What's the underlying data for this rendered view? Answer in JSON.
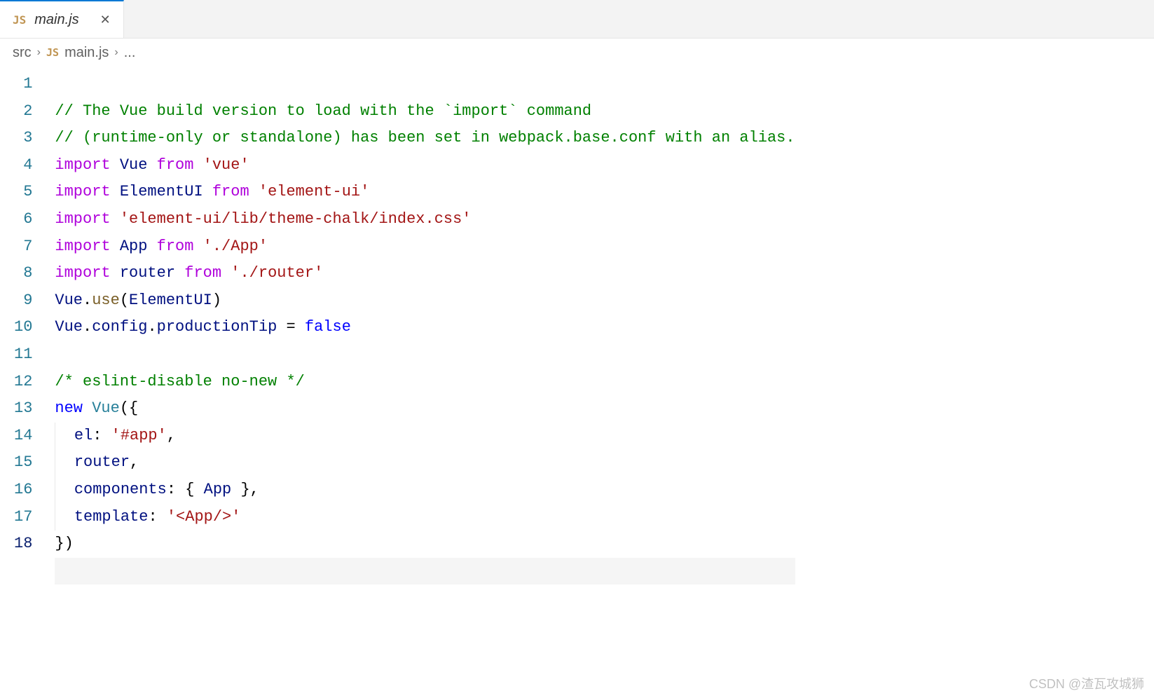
{
  "tab": {
    "icon_label": "JS",
    "filename": "main.js",
    "close_glyph": "✕"
  },
  "breadcrumb": {
    "folder": "src",
    "icon_label": "JS",
    "filename": "main.js",
    "more": "...",
    "chevron": "›"
  },
  "gutter": {
    "lines": [
      "1",
      "2",
      "3",
      "4",
      "5",
      "6",
      "7",
      "8",
      "9",
      "10",
      "11",
      "12",
      "13",
      "14",
      "15",
      "16",
      "17",
      "18"
    ],
    "current_line": "18"
  },
  "code": {
    "l1_comment": "// The Vue build version to load with the `import` command",
    "l2_comment": "// (runtime-only or standalone) has been set in webpack.base.conf with an alias.",
    "l3": {
      "kw": "import",
      "ident": "Vue",
      "from": "from",
      "str": "'vue'"
    },
    "l4": {
      "kw": "import",
      "ident": "ElementUI",
      "from": "from",
      "str": "'element-ui'"
    },
    "l5": {
      "kw": "import",
      "str": "'element-ui/lib/theme-chalk/index.css'"
    },
    "l6": {
      "kw": "import",
      "ident": "App",
      "from": "from",
      "str": "'./App'"
    },
    "l7": {
      "kw": "import",
      "ident": "router",
      "from": "from",
      "str": "'./router'"
    },
    "l8": {
      "a": "Vue",
      "dot1": ".",
      "b": "use",
      "paren": "(",
      "c": "ElementUI",
      "close": ")"
    },
    "l9": {
      "a": "Vue",
      "dot1": ".",
      "b": "config",
      "dot2": ".",
      "c": "productionTip",
      "eq": " = ",
      "val": "false"
    },
    "l11_comment": "/* eslint-disable no-new */",
    "l12": {
      "kw": "new",
      "cls": "Vue",
      "open": "({"
    },
    "l13": {
      "prop": "el",
      "colon": ": ",
      "str": "'#app'",
      "comma": ","
    },
    "l14": {
      "ident": "router",
      "comma": ","
    },
    "l15": {
      "prop": "components",
      "colon": ": ",
      "open": "{ ",
      "ident": "App",
      "close": " }",
      "comma": ","
    },
    "l16": {
      "prop": "template",
      "colon": ": ",
      "str": "'<App/>'"
    },
    "l17_close": "})"
  },
  "watermark": "CSDN @渣瓦攻城狮"
}
